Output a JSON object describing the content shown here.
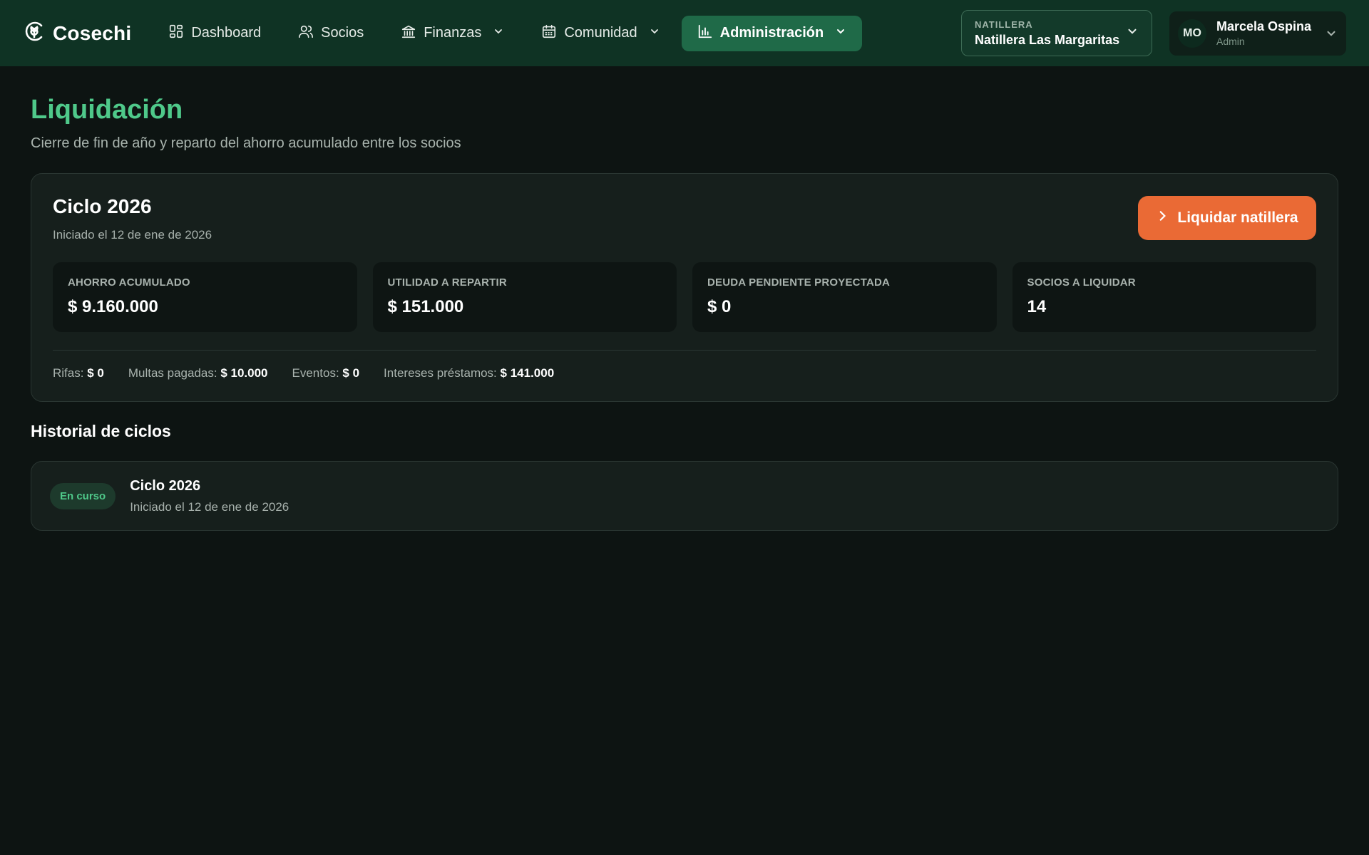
{
  "brand": {
    "name": "Cosechi",
    "icon": "wheat-logo-icon"
  },
  "nav": {
    "items": [
      {
        "label": "Dashboard",
        "icon": "dashboard-icon",
        "has_dropdown": false,
        "active": false
      },
      {
        "label": "Socios",
        "icon": "users-icon",
        "has_dropdown": false,
        "active": false
      },
      {
        "label": "Finanzas",
        "icon": "bank-icon",
        "has_dropdown": true,
        "active": false
      },
      {
        "label": "Comunidad",
        "icon": "calendar-icon",
        "has_dropdown": true,
        "active": false
      },
      {
        "label": "Administración",
        "icon": "bar-chart-icon",
        "has_dropdown": true,
        "active": true
      }
    ]
  },
  "org_selector": {
    "label": "NATILLERA",
    "value": "Natillera Las Margaritas"
  },
  "user": {
    "initials": "MO",
    "name": "Marcela Ospina",
    "role": "Admin"
  },
  "page": {
    "title": "Liquidación",
    "subtitle": "Cierre de fin de año y reparto del ahorro acumulado entre los socios"
  },
  "current_cycle": {
    "title": "Ciclo 2026",
    "started": "Iniciado el 12 de ene de 2026",
    "action_label": "Liquidar natillera",
    "stats": [
      {
        "label": "AHORRO ACUMULADO",
        "value": "$ 9.160.000"
      },
      {
        "label": "UTILIDAD A REPARTIR",
        "value": "$ 151.000"
      },
      {
        "label": "DEUDA PENDIENTE PROYECTADA",
        "value": "$ 0"
      },
      {
        "label": "SOCIOS A LIQUIDAR",
        "value": "14"
      }
    ],
    "breakdown": [
      {
        "label": "Rifas:",
        "value": "$ 0"
      },
      {
        "label": "Multas pagadas:",
        "value": "$ 10.000"
      },
      {
        "label": "Eventos:",
        "value": "$ 0"
      },
      {
        "label": "Intereses préstamos:",
        "value": "$ 141.000"
      }
    ]
  },
  "history": {
    "title": "Historial de ciclos",
    "items": [
      {
        "status": "En curso",
        "title": "Ciclo 2026",
        "started": "Iniciado el 12 de ene de 2026"
      }
    ]
  },
  "colors": {
    "accent": "#4fc98a",
    "nav_bg": "#0f3324",
    "nav_active": "#1f6a48",
    "primary_button": "#ea6a35",
    "background": "#0d1412"
  }
}
